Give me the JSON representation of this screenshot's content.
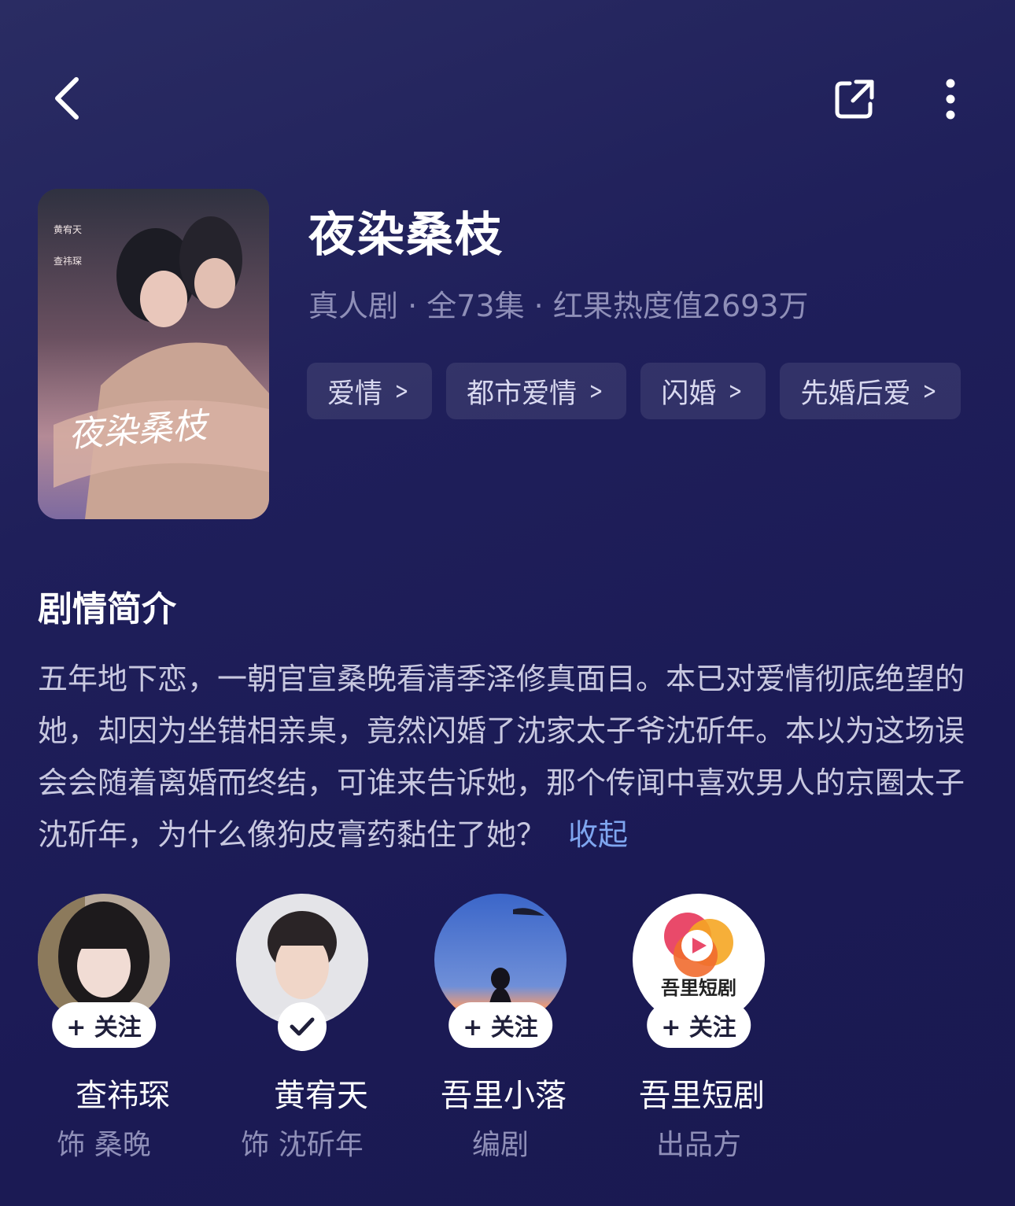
{
  "header": {
    "back_icon": "chevron-left-icon",
    "share_icon": "share-icon",
    "more_icon": "more-vertical-icon"
  },
  "drama": {
    "poster_title": "夜染桑枝",
    "poster_cast": [
      "黄宥天",
      "查祎琛"
    ],
    "title": "夜染桑枝",
    "meta": "真人剧 · 全73集 · 红果热度值2693万",
    "tags": [
      "爱情",
      "都市爱情",
      "闪婚",
      "先婚后爱"
    ]
  },
  "synopsis": {
    "heading": "剧情简介",
    "text": "五年地下恋，一朝官宣桑晚看清季泽修真面目。本已对爱情彻底绝望的她，却因为坐错相亲桌，竟然闪婚了沈家太子爷沈斫年。本以为这场误会会随着离婚而终结，可谁来告诉她，那个传闻中喜欢男人的京圈太子沈斫年，为什么像狗皮膏药黏住了她？",
    "collapse_label": "收起"
  },
  "people": [
    {
      "name": "查祎琛",
      "role": "饰 桑晚",
      "follow_label": "+ 关注",
      "followed": false,
      "avatar": "actress-avatar"
    },
    {
      "name": "黄宥天",
      "role": "饰 沈斫年",
      "follow_label": "",
      "followed": true,
      "avatar": "actor-avatar"
    },
    {
      "name": "吾里小落",
      "role": "编剧",
      "follow_label": "+ 关注",
      "followed": false,
      "avatar": "writer-avatar"
    },
    {
      "name": "吾里短剧",
      "role": "出品方",
      "follow_label": "+ 关注",
      "followed": false,
      "avatar": "producer-logo",
      "logo_text": "吾里短剧"
    }
  ],
  "colors": {
    "background": "#1f1f5a",
    "meta_text": "#8f8fb8",
    "link": "#7fa6f0"
  }
}
